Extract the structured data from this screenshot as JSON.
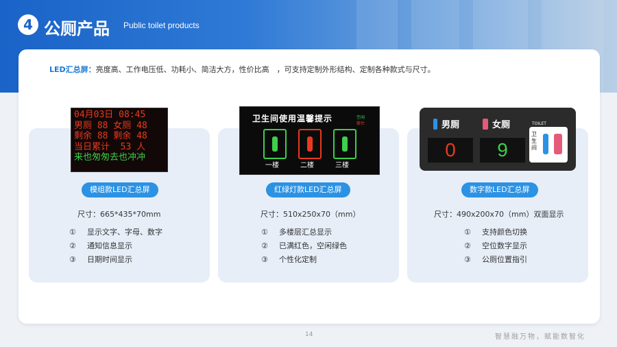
{
  "header": {
    "section_number": "4",
    "title": "公厕产品",
    "subtitle": "Public toilet products"
  },
  "intro": {
    "keyword": "LED汇总屏：",
    "text": "亮度高、工作电压低、功耗小、简洁大方，性价比高　，可支持定制外形结构、定制各种款式与尺寸。"
  },
  "products": [
    {
      "name": "模组款LED汇总屏",
      "size": "尺寸：665*435*70mm",
      "features": [
        {
          "n": "①",
          "text": "显示文字、字母、数字"
        },
        {
          "n": "②",
          "text": "通知信息显示"
        },
        {
          "n": "③",
          "text": "日期时间显示"
        }
      ],
      "display": {
        "lines": [
          "04月03日 08:45",
          "男厕 88 女厕 48",
          "剩余 88 剩余 48",
          "当日累计  53 人",
          "来也匆匆去也冲冲"
        ]
      }
    },
    {
      "name": "红绿灯款LED汇总屏",
      "size": "尺寸：510x250x70（mm）",
      "features": [
        {
          "n": "①",
          "text": "多楼层汇总显示"
        },
        {
          "n": "②",
          "text": "已满红色，空闲绿色"
        },
        {
          "n": "③",
          "text": "个性化定制"
        }
      ],
      "display": {
        "heading": "卫生间使用温馨提示",
        "floors": [
          "一楼",
          "二楼",
          "三楼"
        ],
        "legend": [
          "空闲",
          "繁忙"
        ]
      }
    },
    {
      "name": "数字款LED汇总屏",
      "size": "尺寸：490x200x70（mm）双面显示",
      "features": [
        {
          "n": "①",
          "text": "支持颜色切换"
        },
        {
          "n": "②",
          "text": "空位数字显示"
        },
        {
          "n": "③",
          "text": "公厕位置指引"
        }
      ],
      "display": {
        "men_label": "男厕",
        "women_label": "女厕",
        "men_count": "0",
        "women_count": "9",
        "toilet_sign": "TOILET",
        "toilet_text": "卫生间"
      }
    }
  ],
  "footer": {
    "page_number": "14",
    "slogan": "智慧融万物，赋能数智化"
  },
  "colors": {
    "accent": "#2b92e4",
    "led_red": "#e83a1e",
    "led_green": "#3fcf4a"
  }
}
